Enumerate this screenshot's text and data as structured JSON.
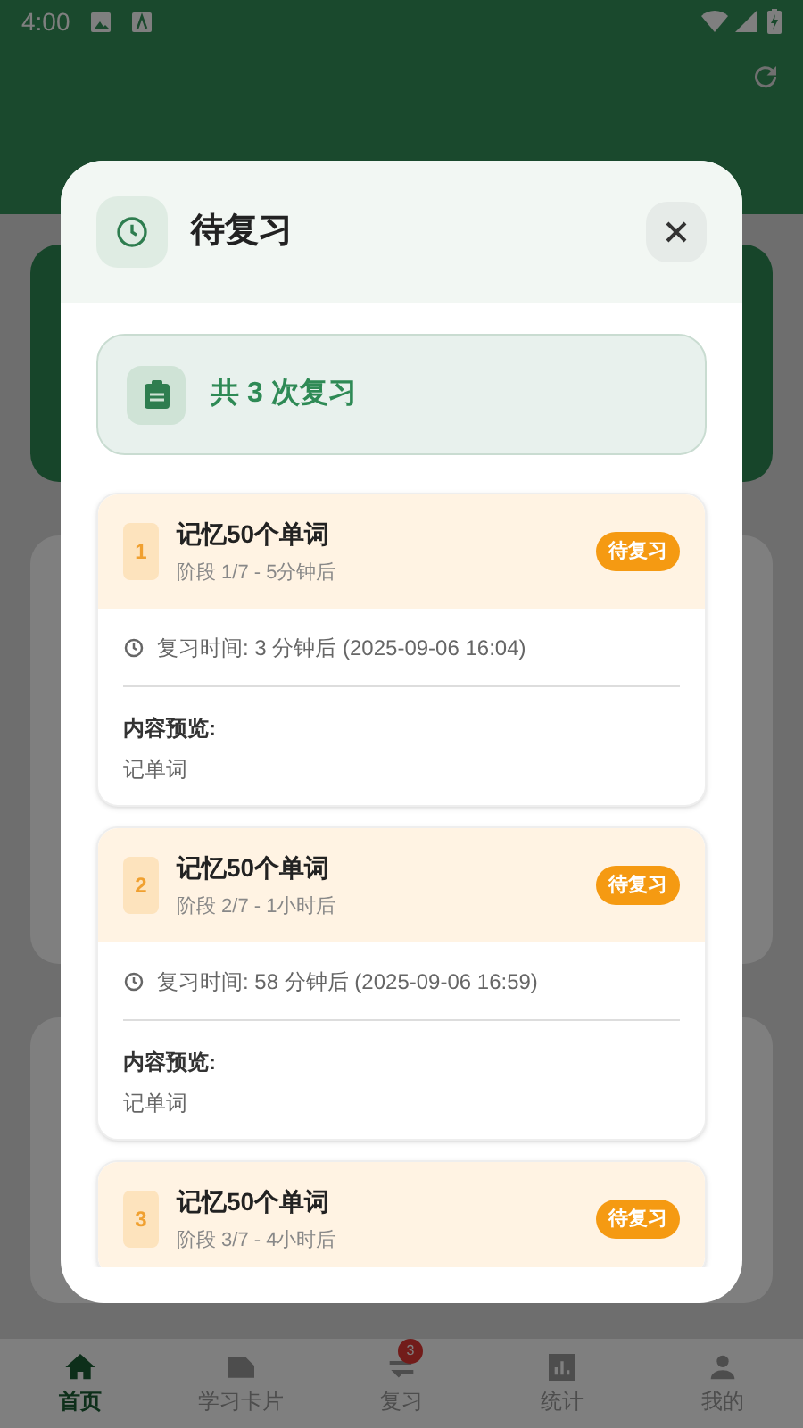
{
  "status_bar": {
    "time": "4:00"
  },
  "dialog": {
    "title": "待复习",
    "summary": "共 3 次复习",
    "items": [
      {
        "index": "1",
        "title": "记忆50个单词",
        "stage": "阶段 1/7 - 5分钟后",
        "badge": "待复习",
        "review_time": "复习时间: 3 分钟后 (2025-09-06 16:04)",
        "preview_label": "内容预览:",
        "preview": "记单词"
      },
      {
        "index": "2",
        "title": "记忆50个单词",
        "stage": "阶段 2/7 - 1小时后",
        "badge": "待复习",
        "review_time": "复习时间: 58 分钟后 (2025-09-06 16:59)",
        "preview_label": "内容预览:",
        "preview": "记单词"
      },
      {
        "index": "3",
        "title": "记忆50个单词",
        "stage": "阶段 3/7 - 4小时后",
        "badge": "待复习"
      }
    ]
  },
  "bottom_nav": [
    {
      "label": "首页",
      "kind": "home",
      "selected": true
    },
    {
      "label": "学习卡片",
      "kind": "card",
      "selected": false
    },
    {
      "label": "复习",
      "kind": "review",
      "selected": false,
      "badge": "3"
    },
    {
      "label": "统计",
      "kind": "stats",
      "selected": false
    },
    {
      "label": "我的",
      "kind": "person",
      "selected": false
    }
  ]
}
